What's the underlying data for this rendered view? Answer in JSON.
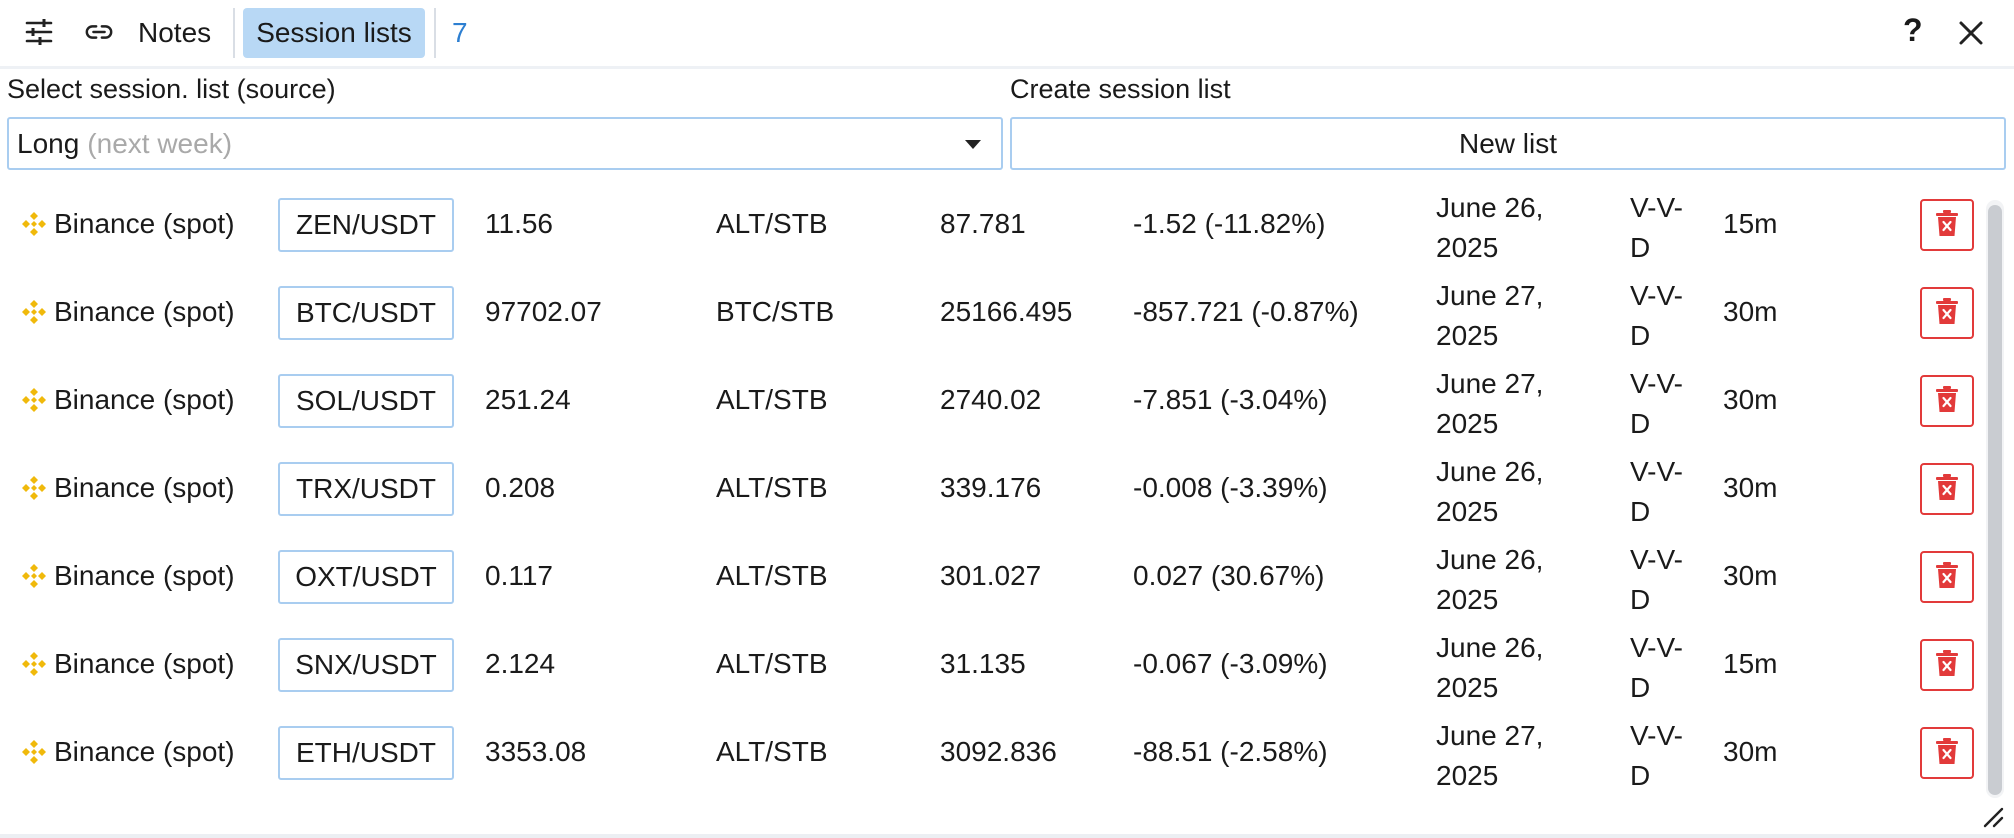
{
  "toolbar": {
    "notes_label": "Notes",
    "session_lists_label": "Session lists",
    "count": "7",
    "help_label": "?"
  },
  "source": {
    "label": "Select session. list (source)",
    "selected_value": "Long",
    "selected_hint": "(next week)"
  },
  "create": {
    "label": "Create session list",
    "button_label": "New list"
  },
  "colors": {
    "accent": "#b8d8f5",
    "link": "#2d7fd1",
    "danger": "#e23a3a",
    "exchange_icon": "#f0b90b"
  },
  "rows": [
    {
      "exchange": "Binance (spot)",
      "pair": "ZEN/USDT",
      "price": "11.56",
      "type": "ALT/STB",
      "volume": "87.781",
      "change": "-1.52 (-11.82%)",
      "date_line1": "June 26,",
      "date_line2": "2025",
      "mode_line1": "V-V-",
      "mode_line2": "D",
      "timeframe": "15m"
    },
    {
      "exchange": "Binance (spot)",
      "pair": "BTC/USDT",
      "price": "97702.07",
      "type": "BTC/STB",
      "volume": "25166.495",
      "change": "-857.721 (-0.87%)",
      "date_line1": "June 27,",
      "date_line2": "2025",
      "mode_line1": "V-V-",
      "mode_line2": "D",
      "timeframe": "30m"
    },
    {
      "exchange": "Binance (spot)",
      "pair": "SOL/USDT",
      "price": "251.24",
      "type": "ALT/STB",
      "volume": "2740.02",
      "change": "-7.851 (-3.04%)",
      "date_line1": "June 27,",
      "date_line2": "2025",
      "mode_line1": "V-V-",
      "mode_line2": "D",
      "timeframe": "30m"
    },
    {
      "exchange": "Binance (spot)",
      "pair": "TRX/USDT",
      "price": "0.208",
      "type": "ALT/STB",
      "volume": "339.176",
      "change": "-0.008 (-3.39%)",
      "date_line1": "June 26,",
      "date_line2": "2025",
      "mode_line1": "V-V-",
      "mode_line2": "D",
      "timeframe": "30m"
    },
    {
      "exchange": "Binance (spot)",
      "pair": "OXT/USDT",
      "price": "0.117",
      "type": "ALT/STB",
      "volume": "301.027",
      "change": "0.027 (30.67%)",
      "date_line1": "June 26,",
      "date_line2": "2025",
      "mode_line1": "V-V-",
      "mode_line2": "D",
      "timeframe": "30m"
    },
    {
      "exchange": "Binance (spot)",
      "pair": "SNX/USDT",
      "price": "2.124",
      "type": "ALT/STB",
      "volume": "31.135",
      "change": "-0.067 (-3.09%)",
      "date_line1": "June 26,",
      "date_line2": "2025",
      "mode_line1": "V-V-",
      "mode_line2": "D",
      "timeframe": "15m"
    },
    {
      "exchange": "Binance (spot)",
      "pair": "ETH/USDT",
      "price": "3353.08",
      "type": "ALT/STB",
      "volume": "3092.836",
      "change": "-88.51 (-2.58%)",
      "date_line1": "June 27,",
      "date_line2": "2025",
      "mode_line1": "V-V-",
      "mode_line2": "D",
      "timeframe": "30m"
    }
  ]
}
